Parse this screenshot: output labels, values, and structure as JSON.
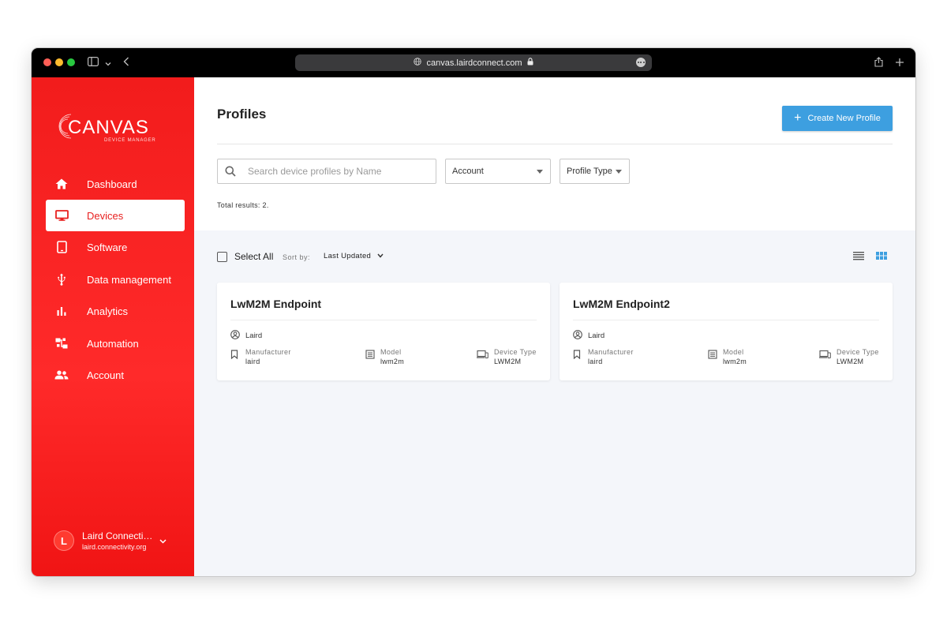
{
  "browser": {
    "url": "canvas.lairdconnect.com"
  },
  "sidebar": {
    "logo_text": "CANVAS",
    "logo_tagline": "DEVICE MANAGER",
    "items": [
      {
        "label": "Dashboard",
        "icon": "home-icon"
      },
      {
        "label": "Devices",
        "icon": "monitor-icon"
      },
      {
        "label": "Software",
        "icon": "tablet-icon"
      },
      {
        "label": "Data management",
        "icon": "usb-icon"
      },
      {
        "label": "Analytics",
        "icon": "bar-chart-icon"
      },
      {
        "label": "Automation",
        "icon": "flow-icon"
      },
      {
        "label": "Account",
        "icon": "people-icon"
      }
    ],
    "active_item": "Devices",
    "user": {
      "initial": "L",
      "name": "Laird Connectivity",
      "email": "laird.connectivity.org"
    }
  },
  "header": {
    "title": "Profiles",
    "create_label": "Create New Profile"
  },
  "filters": {
    "search_placeholder": "Search device profiles by Name",
    "account_label": "Account",
    "profile_type_label": "Profile Type"
  },
  "results": {
    "total_text": "Total results: 2."
  },
  "toolbar": {
    "select_all_label": "Select All",
    "sort_label": "Sort by:",
    "sort_value": "Last Updated"
  },
  "profiles": [
    {
      "name": "LwM2M Endpoint",
      "owner": "Laird",
      "manufacturer_label": "Manufacturer",
      "manufacturer": "laird",
      "model_label": "Model",
      "model": "lwm2m",
      "device_type_label": "Device Type",
      "device_type": "LWM2M"
    },
    {
      "name": "LwM2M Endpoint2",
      "owner": "Laird",
      "manufacturer_label": "Manufacturer",
      "manufacturer": "laird",
      "model_label": "Model",
      "model": "lwm2m",
      "device_type_label": "Device Type",
      "device_type": "LWM2M"
    }
  ],
  "colors": {
    "brand_red": "#f21c1c",
    "accent_blue": "#3d9fe0",
    "content_bg": "#f4f6fa"
  }
}
